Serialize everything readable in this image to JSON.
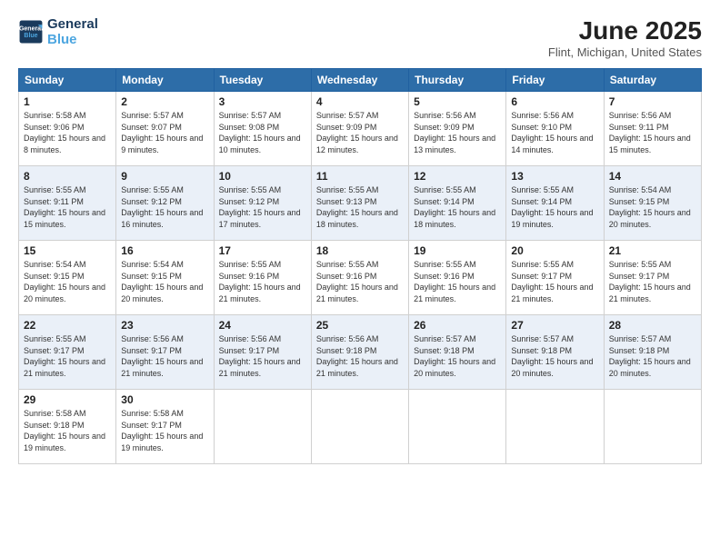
{
  "logo": {
    "line1": "General",
    "line2": "Blue"
  },
  "title": "June 2025",
  "subtitle": "Flint, Michigan, United States",
  "days_header": [
    "Sunday",
    "Monday",
    "Tuesday",
    "Wednesday",
    "Thursday",
    "Friday",
    "Saturday"
  ],
  "weeks": [
    [
      {
        "num": "1",
        "rise": "5:58 AM",
        "set": "9:06 PM",
        "daylight": "15 hours and 8 minutes."
      },
      {
        "num": "2",
        "rise": "5:57 AM",
        "set": "9:07 PM",
        "daylight": "15 hours and 9 minutes."
      },
      {
        "num": "3",
        "rise": "5:57 AM",
        "set": "9:08 PM",
        "daylight": "15 hours and 10 minutes."
      },
      {
        "num": "4",
        "rise": "5:57 AM",
        "set": "9:09 PM",
        "daylight": "15 hours and 12 minutes."
      },
      {
        "num": "5",
        "rise": "5:56 AM",
        "set": "9:09 PM",
        "daylight": "15 hours and 13 minutes."
      },
      {
        "num": "6",
        "rise": "5:56 AM",
        "set": "9:10 PM",
        "daylight": "15 hours and 14 minutes."
      },
      {
        "num": "7",
        "rise": "5:56 AM",
        "set": "9:11 PM",
        "daylight": "15 hours and 15 minutes."
      }
    ],
    [
      {
        "num": "8",
        "rise": "5:55 AM",
        "set": "9:11 PM",
        "daylight": "15 hours and 15 minutes."
      },
      {
        "num": "9",
        "rise": "5:55 AM",
        "set": "9:12 PM",
        "daylight": "15 hours and 16 minutes."
      },
      {
        "num": "10",
        "rise": "5:55 AM",
        "set": "9:12 PM",
        "daylight": "15 hours and 17 minutes."
      },
      {
        "num": "11",
        "rise": "5:55 AM",
        "set": "9:13 PM",
        "daylight": "15 hours and 18 minutes."
      },
      {
        "num": "12",
        "rise": "5:55 AM",
        "set": "9:14 PM",
        "daylight": "15 hours and 18 minutes."
      },
      {
        "num": "13",
        "rise": "5:55 AM",
        "set": "9:14 PM",
        "daylight": "15 hours and 19 minutes."
      },
      {
        "num": "14",
        "rise": "5:54 AM",
        "set": "9:15 PM",
        "daylight": "15 hours and 20 minutes."
      }
    ],
    [
      {
        "num": "15",
        "rise": "5:54 AM",
        "set": "9:15 PM",
        "daylight": "15 hours and 20 minutes."
      },
      {
        "num": "16",
        "rise": "5:54 AM",
        "set": "9:15 PM",
        "daylight": "15 hours and 20 minutes."
      },
      {
        "num": "17",
        "rise": "5:55 AM",
        "set": "9:16 PM",
        "daylight": "15 hours and 21 minutes."
      },
      {
        "num": "18",
        "rise": "5:55 AM",
        "set": "9:16 PM",
        "daylight": "15 hours and 21 minutes."
      },
      {
        "num": "19",
        "rise": "5:55 AM",
        "set": "9:16 PM",
        "daylight": "15 hours and 21 minutes."
      },
      {
        "num": "20",
        "rise": "5:55 AM",
        "set": "9:17 PM",
        "daylight": "15 hours and 21 minutes."
      },
      {
        "num": "21",
        "rise": "5:55 AM",
        "set": "9:17 PM",
        "daylight": "15 hours and 21 minutes."
      }
    ],
    [
      {
        "num": "22",
        "rise": "5:55 AM",
        "set": "9:17 PM",
        "daylight": "15 hours and 21 minutes."
      },
      {
        "num": "23",
        "rise": "5:56 AM",
        "set": "9:17 PM",
        "daylight": "15 hours and 21 minutes."
      },
      {
        "num": "24",
        "rise": "5:56 AM",
        "set": "9:17 PM",
        "daylight": "15 hours and 21 minutes."
      },
      {
        "num": "25",
        "rise": "5:56 AM",
        "set": "9:18 PM",
        "daylight": "15 hours and 21 minutes."
      },
      {
        "num": "26",
        "rise": "5:57 AM",
        "set": "9:18 PM",
        "daylight": "15 hours and 20 minutes."
      },
      {
        "num": "27",
        "rise": "5:57 AM",
        "set": "9:18 PM",
        "daylight": "15 hours and 20 minutes."
      },
      {
        "num": "28",
        "rise": "5:57 AM",
        "set": "9:18 PM",
        "daylight": "15 hours and 20 minutes."
      }
    ],
    [
      {
        "num": "29",
        "rise": "5:58 AM",
        "set": "9:18 PM",
        "daylight": "15 hours and 19 minutes."
      },
      {
        "num": "30",
        "rise": "5:58 AM",
        "set": "9:17 PM",
        "daylight": "15 hours and 19 minutes."
      },
      null,
      null,
      null,
      null,
      null
    ]
  ]
}
